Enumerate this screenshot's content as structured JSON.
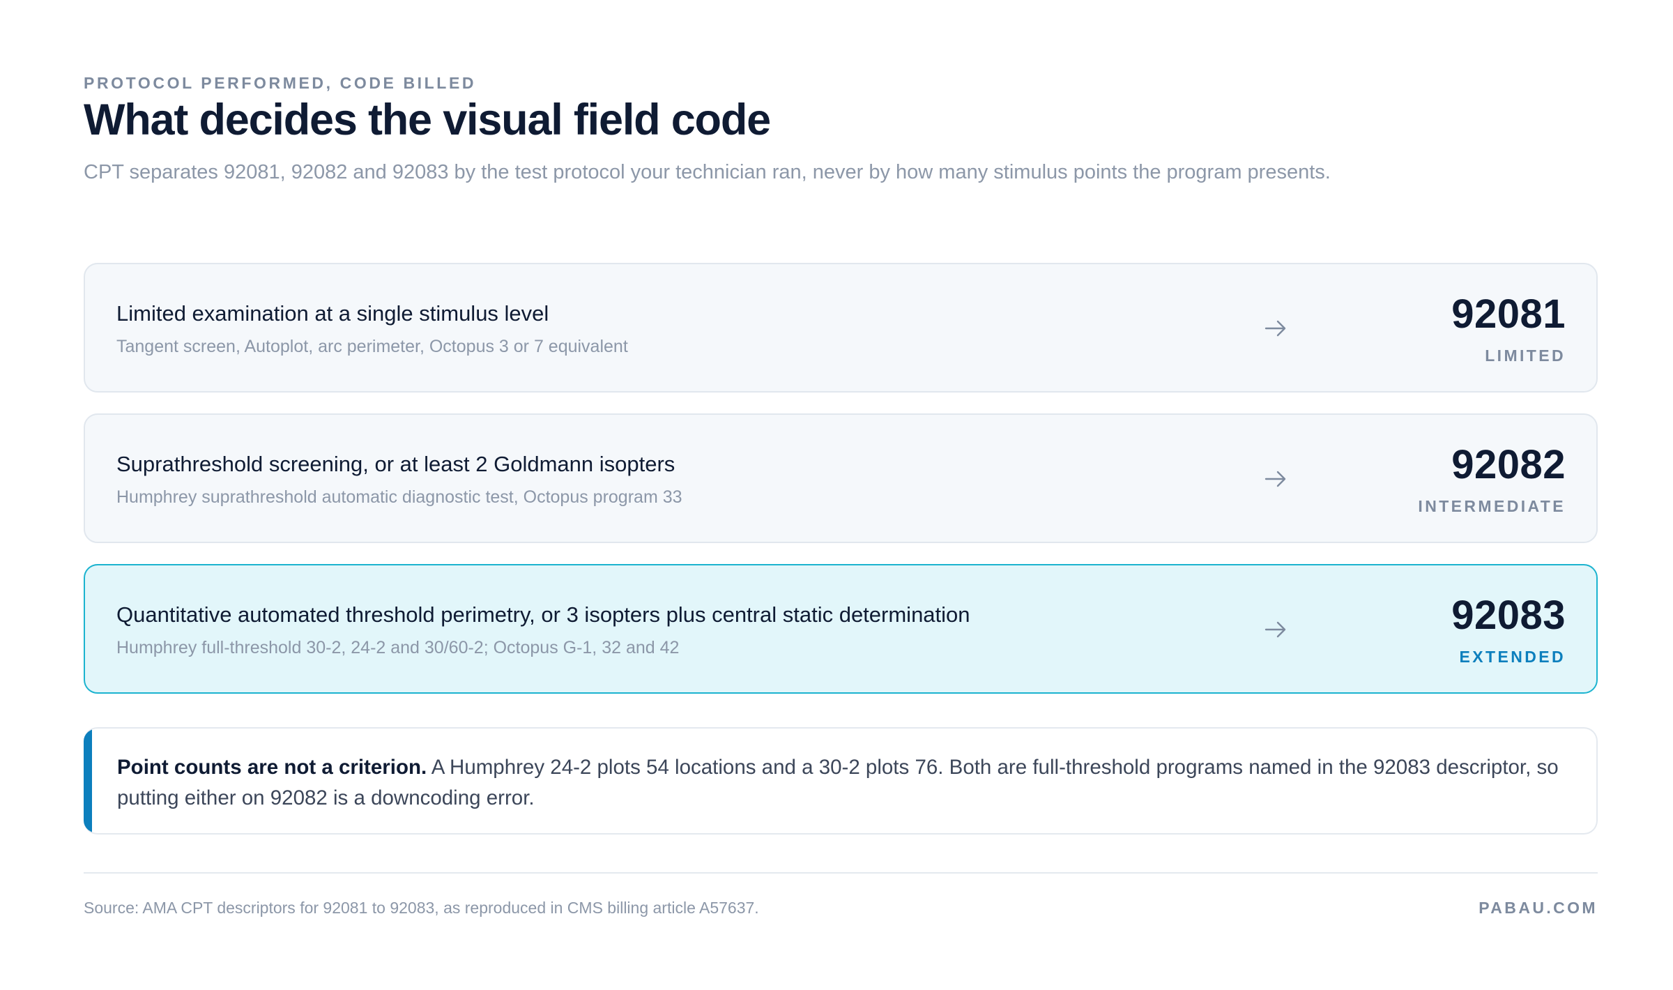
{
  "header": {
    "eyebrow": "PROTOCOL PERFORMED, CODE BILLED",
    "title": "What decides the visual field code",
    "subtitle": "CPT separates 92081, 92082 and 92083 by the test protocol your technician ran, never by how many stimulus points the program presents."
  },
  "rows": [
    {
      "heading": "Limited examination at a single stimulus level",
      "detail": "Tangent screen, Autoplot, arc perimeter, Octopus 3 or 7 equivalent",
      "code": "92081",
      "tier": "LIMITED"
    },
    {
      "heading": "Suprathreshold screening, or at least 2 Goldmann isopters",
      "detail": "Humphrey suprathreshold automatic diagnostic test, Octopus program 33",
      "code": "92082",
      "tier": "INTERMEDIATE"
    },
    {
      "heading": "Quantitative automated threshold perimetry, or 3 isopters plus central static determination",
      "detail": "Humphrey full-threshold 30-2, 24-2 and 30/60-2; Octopus G-1, 32 and 42",
      "code": "92083",
      "tier": "EXTENDED"
    }
  ],
  "arrow_icon": "arrow-right-icon",
  "callout": {
    "lead": "Point counts are not a criterion.",
    "body": " A Humphrey 24-2 plots 54 locations and a 30-2 plots 76. Both are full-threshold programs named in the 92083 descriptor, so putting either on 92082 is a downcoding error."
  },
  "footer": {
    "source": "Source: AMA CPT descriptors for 92081 to 92083, as reproduced in CMS billing article A57637.",
    "brand": "PABAU.COM"
  },
  "colors": {
    "ink": "#0f1b33",
    "muted": "#8c97a8",
    "accent": "#0c7fbd",
    "highlight_border": "#1bb3cf",
    "highlight_fill": "#e2f6fa",
    "row_fill": "#f5f8fb"
  }
}
